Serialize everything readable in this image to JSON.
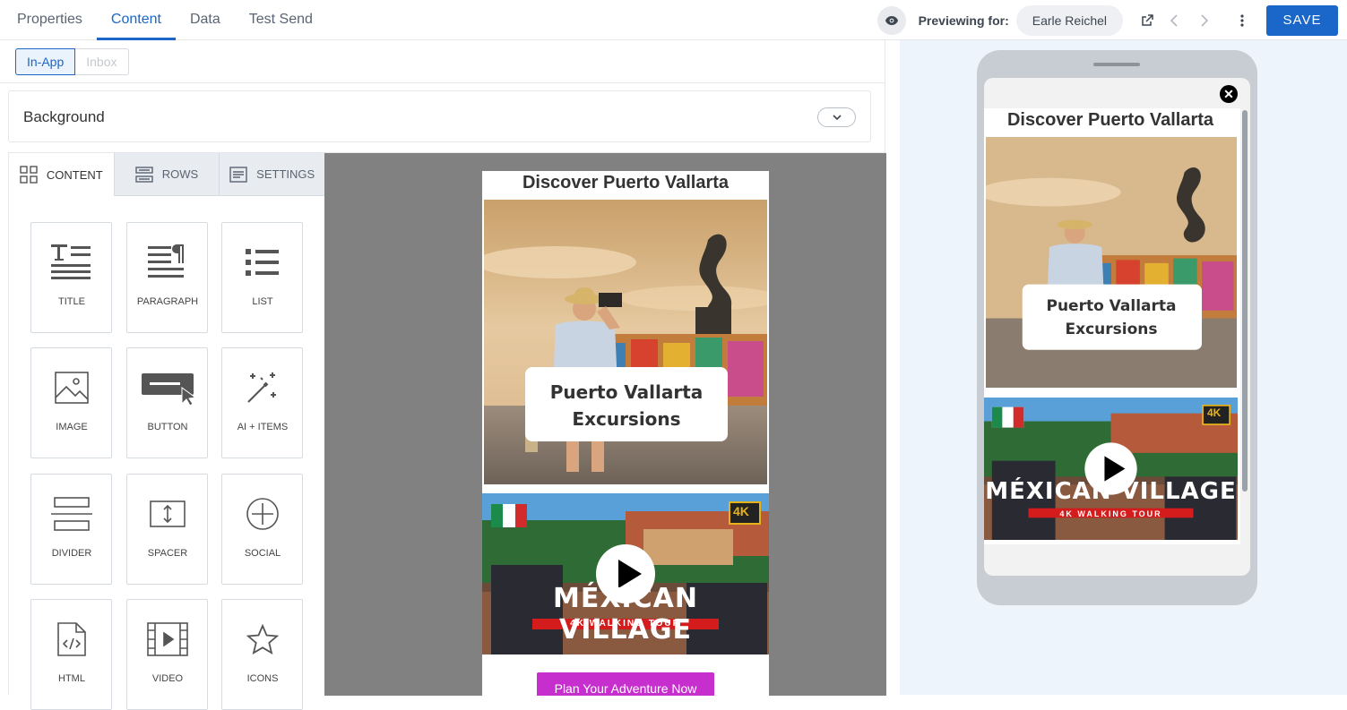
{
  "topbar": {
    "tabs": [
      "Properties",
      "Content",
      "Data",
      "Test Send"
    ],
    "previewing_label": "Previewing for:",
    "user_name": "Earle Reichel",
    "save_label": "SAVE"
  },
  "subtabs": [
    "In-App",
    "Inbox"
  ],
  "background_label": "Background",
  "panel": {
    "tabs": [
      "CONTENT",
      "ROWS",
      "SETTINGS"
    ],
    "tiles": [
      "TITLE",
      "PARAGRAPH",
      "LIST",
      "IMAGE",
      "BUTTON",
      "AI + ITEMS",
      "DIVIDER",
      "SPACER",
      "SOCIAL",
      "HTML",
      "VIDEO",
      "ICONS"
    ]
  },
  "email": {
    "title": "Discover Puerto Vallarta",
    "hero_caption_line1": "Puerto Vallarta",
    "hero_caption_line2": "Excursions",
    "video_title": "MÉXICAN VILLAGE",
    "video_subtitle": "4K WALKING TOUR",
    "video_badge": "4K",
    "cta_label": "Plan Your Adventure Now"
  },
  "colors": {
    "accent": "#1a66c9",
    "cta": "#c62fce",
    "canvas": "#818181"
  }
}
